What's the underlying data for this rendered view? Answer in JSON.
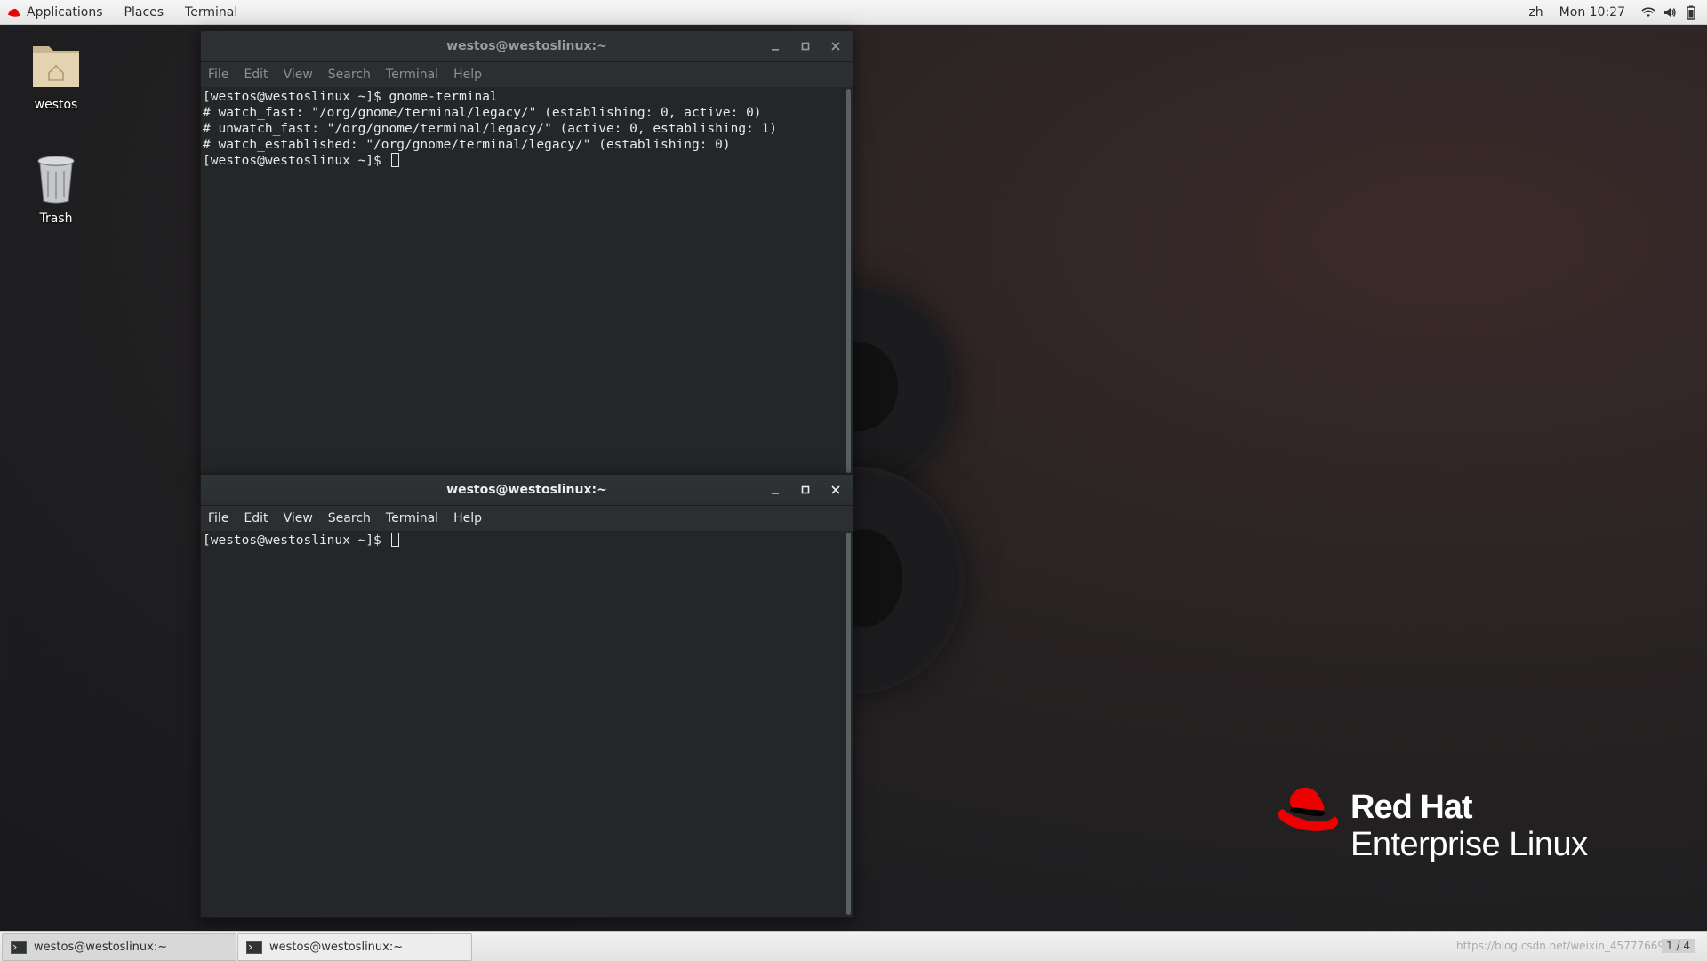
{
  "topbar": {
    "applications": "Applications",
    "places": "Places",
    "terminal": "Terminal",
    "input_method": "zh",
    "clock": "Mon 10:27"
  },
  "desktop": {
    "home_label": "westos",
    "trash_label": "Trash"
  },
  "windows": [
    {
      "title": "westos@westoslinux:~",
      "menu": [
        "File",
        "Edit",
        "View",
        "Search",
        "Terminal",
        "Help"
      ],
      "lines": [
        "[westos@westoslinux ~]$ gnome-terminal",
        "# watch_fast: \"/org/gnome/terminal/legacy/\" (establishing: 0, active: 0)",
        "# unwatch_fast: \"/org/gnome/terminal/legacy/\" (active: 0, establishing: 1)",
        "# watch_established: \"/org/gnome/terminal/legacy/\" (establishing: 0)",
        "[westos@westoslinux ~]$ "
      ],
      "active": false
    },
    {
      "title": "westos@westoslinux:~",
      "menu": [
        "File",
        "Edit",
        "View",
        "Search",
        "Terminal",
        "Help"
      ],
      "lines": [
        "[westos@westoslinux ~]$ "
      ],
      "active": true
    }
  ],
  "logo": {
    "line1": "Red Hat",
    "line2": "Enterprise Linux",
    "brand_color": "#ee0000"
  },
  "taskbar": {
    "tasks": [
      "westos@westoslinux:~",
      "westos@westoslinux:~"
    ],
    "workspace": "1 / 4",
    "watermark": "https://blog.csdn.net/weixin_45777669"
  }
}
